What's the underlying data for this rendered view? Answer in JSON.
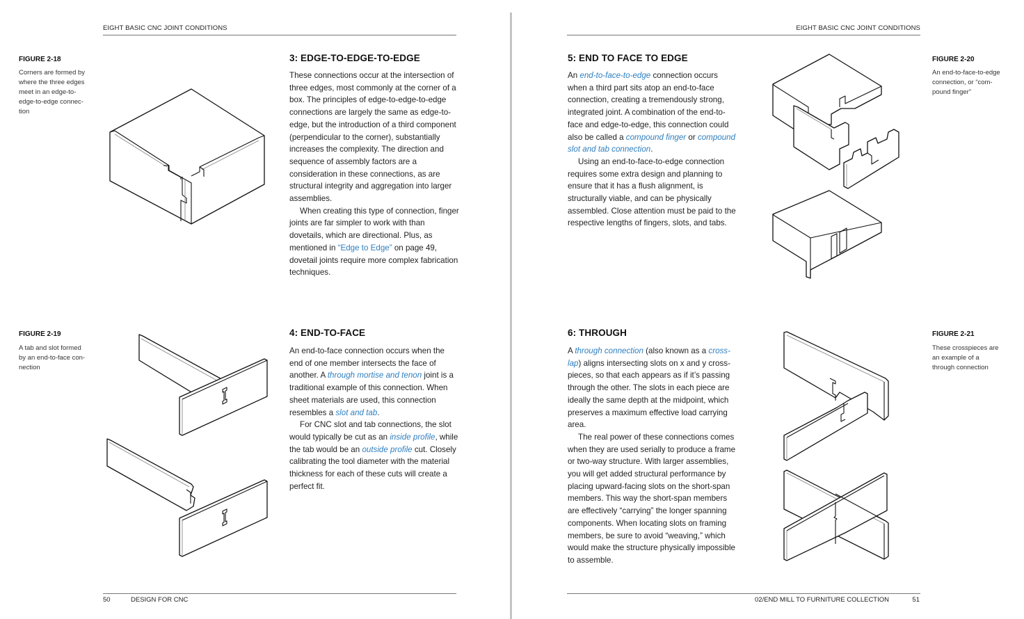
{
  "spread": {
    "left_page": {
      "running_head": "EIGHT BASIC CNC JOINT CONDITIONS",
      "folio": {
        "page_number": "50",
        "title": "DESIGN FOR CNC"
      },
      "figures": [
        {
          "label": "FIGURE 2-18",
          "caption": "Corners are formed by where the three edges meet in an edge-to-edge-to-edge connection",
          "caption_lines": [
            "Corners are formed by",
            "where the three edges",
            "meet in an edge-to-",
            "edge-to-edge connec-",
            "tion"
          ],
          "icon": "box-corner-finger-joint-illustration"
        },
        {
          "label": "FIGURE 2-19",
          "caption": "A tab and slot formed by an end-to-face connection",
          "caption_lines": [
            "A tab and slot formed",
            "by an end-to-face con-",
            "nection"
          ],
          "icon": "tab-and-slot-illustration"
        }
      ],
      "sections": [
        {
          "title": "3: EDGE-TO-EDGE-TO-EDGE",
          "paragraphs": [
            [
              {
                "text": "These connections occur at the intersection of three edges, most commonly at the corner of a box. The principles of edge-to-edge-to-edge connections are largely the same as edge-to-edge, but the introduction of a third component (perpendicular to the corner), substantially increases the complexity. The direction and sequence of assembly factors are a consideration in these connections, as are structural integrity and aggregation into larger assemblies."
              }
            ],
            [
              {
                "text": "When creating this type of connection, finger joints are far simpler to work with than dovetails, which are directional. Plus, as mentioned in "
              },
              {
                "text": "“Edge to Edge”",
                "link": true,
                "italic": false
              },
              {
                "text": " on page 49, dovetail joints require more complex fabrication techniques."
              }
            ]
          ]
        },
        {
          "title": "4: END-TO-FACE",
          "paragraphs": [
            [
              {
                "text": "An end-to-face connection occurs when the end of one member intersects the face of another. A "
              },
              {
                "text": "through mortise and tenon",
                "link": true,
                "italic": true
              },
              {
                "text": " joint is a traditional example of this connection. When sheet materials are used, this connection resembles a "
              },
              {
                "text": "slot and tab",
                "link": true,
                "italic": true
              },
              {
                "text": "."
              }
            ],
            [
              {
                "text": "For CNC slot and tab connections, the slot would typically be cut as an "
              },
              {
                "text": "inside profile",
                "link": true,
                "italic": true
              },
              {
                "text": ", while the tab would be an "
              },
              {
                "text": "outside profile",
                "link": true,
                "italic": true
              },
              {
                "text": " cut. Closely calibrating the tool diameter with the material thickness for each of these cuts will create a perfect fit."
              }
            ]
          ]
        }
      ]
    },
    "right_page": {
      "running_head": "EIGHT BASIC CNC JOINT CONDITIONS",
      "folio": {
        "page_number": "51",
        "title": "02/END MILL TO FURNITURE COLLECTION"
      },
      "figures": [
        {
          "label": "FIGURE 2-20",
          "caption": "An end-to-face-to-edge connection, or “compound finger”",
          "caption_lines": [
            "An end-to-face-to-edge",
            "connection, or “com-",
            "pound finger”"
          ],
          "icon": "compound-finger-joint-illustration"
        },
        {
          "label": "FIGURE 2-21",
          "caption": "These crosspieces are an example of a through connection",
          "caption_lines": [
            "These crosspieces are",
            "an example of a",
            "through connection"
          ],
          "icon": "cross-lap-illustration"
        }
      ],
      "sections": [
        {
          "title": "5: END TO FACE TO EDGE",
          "paragraphs": [
            [
              {
                "text": "An "
              },
              {
                "text": "end-to-face-to-edge",
                "link": true,
                "italic": true
              },
              {
                "text": " connection occurs when a third part sits atop an end-to-face connection, creating a tremendously strong, integrated joint. A combination of the end-to-face and edge-to-edge, this connection could also be called a "
              },
              {
                "text": "compound finger",
                "link": true,
                "italic": true
              },
              {
                "text": " or "
              },
              {
                "text": "compound slot and tab connection",
                "link": true,
                "italic": true
              },
              {
                "text": "."
              }
            ],
            [
              {
                "text": "Using an end-to-face-to-edge connection requires some extra design and planning to ensure that it has a flush alignment, is structurally viable, and can be physically assembled. Close attention must be paid to the respective lengths of fingers, slots, and tabs."
              }
            ]
          ]
        },
        {
          "title": "6: THROUGH",
          "paragraphs": [
            [
              {
                "text": "A "
              },
              {
                "text": "through connection",
                "link": true,
                "italic": true
              },
              {
                "text": " (also known as a "
              },
              {
                "text": "cross-lap",
                "link": true,
                "italic": true
              },
              {
                "text": ") aligns intersecting slots on x and y cross-pieces, so that each appears as if it’s passing through the other. The slots in each piece are ideally the same depth at the midpoint, which preserves a maximum effective load carrying area."
              }
            ],
            [
              {
                "text": "The real power of these connections comes when they are used serially to produce a frame or two-way structure. With larger assemblies, you will get added structural performance by placing upward-facing slots on the short-span members. This way the short-span members are effectively “carrying” the longer spanning components. When locating slots on framing members, be sure to avoid “weaving,” which would make the structure physically impossible to assemble."
              }
            ]
          ]
        }
      ]
    },
    "colors": {
      "link": "#2f7fbf",
      "text": "#222222",
      "rule": "#777777",
      "spine": "#c4c4c4"
    }
  }
}
